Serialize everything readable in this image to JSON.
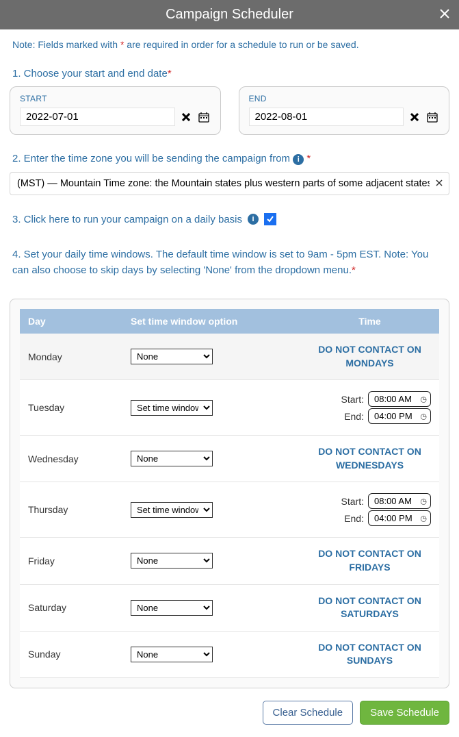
{
  "header": {
    "title": "Campaign Scheduler"
  },
  "note": {
    "prefix": "Note: Fields marked with ",
    "suffix": " are required in order for a schedule to run or be saved."
  },
  "section1": {
    "title": "1. Choose your start and end date",
    "start": {
      "label": "START",
      "value": "2022-07-01"
    },
    "end": {
      "label": "END",
      "value": "2022-08-01"
    }
  },
  "section2": {
    "title": "2. Enter the time zone you will be sending the campaign from ",
    "value": "(MST) — Mountain Time zone: the Mountain states plus western parts of some adjacent states"
  },
  "section3": {
    "title": "3. Click here to run your campaign on a daily basis",
    "checked": true
  },
  "section4": {
    "title": "4. Set your daily time windows. The default time window is set to 9am - 5pm EST. Note: You can also choose to skip days by selecting 'None' from the dropdown menu."
  },
  "table": {
    "headers": {
      "day": "Day",
      "option": "Set time window option",
      "time": "Time"
    },
    "options": {
      "none": "None",
      "set": "Set time windows:"
    },
    "timeLabels": {
      "start": "Start:",
      "end": "End:"
    },
    "rows": [
      {
        "day": "Monday",
        "option": "none",
        "nocontact": "DO NOT CONTACT ON MONDAYS"
      },
      {
        "day": "Tuesday",
        "option": "set",
        "start": "08:00 AM",
        "end": "04:00 PM"
      },
      {
        "day": "Wednesday",
        "option": "none",
        "nocontact": "DO NOT CONTACT ON WEDNESDAYS"
      },
      {
        "day": "Thursday",
        "option": "set",
        "start": "08:00 AM",
        "end": "04:00 PM"
      },
      {
        "day": "Friday",
        "option": "none",
        "nocontact": "DO NOT CONTACT ON FRIDAYS"
      },
      {
        "day": "Saturday",
        "option": "none",
        "nocontact": "DO NOT CONTACT ON SATURDAYS"
      },
      {
        "day": "Sunday",
        "option": "none",
        "nocontact": "DO NOT CONTACT ON SUNDAYS"
      }
    ]
  },
  "footer": {
    "clear": "Clear Schedule",
    "save": "Save Schedule"
  }
}
